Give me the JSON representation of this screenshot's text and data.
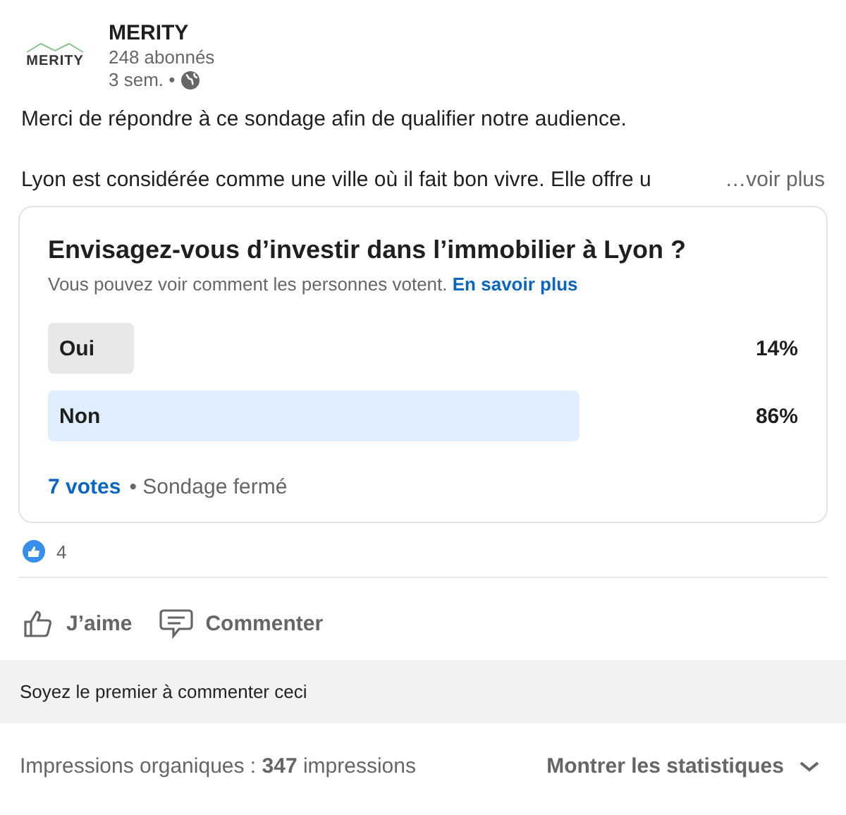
{
  "author": {
    "name": "MERITY",
    "logo_text": "MERITY",
    "followers": "248 abonnés",
    "time": "3 sem. •"
  },
  "body": {
    "lines": [
      "Merci de répondre à ce sondage afin de qualifier notre audience.",
      "Lyon est considérée comme une ville où il fait bon vivre. Elle offre u"
    ],
    "more": "…voir plus"
  },
  "poll": {
    "question": "Envisagez-vous d’investir dans l’immobilier à Lyon ?",
    "note": "Vous pouvez voir comment les personnes votent.",
    "note_link": "En savoir plus",
    "options": [
      {
        "label": "Oui",
        "percent": "14%",
        "level": 0.14,
        "selected": false
      },
      {
        "label": "Non",
        "percent": "86%",
        "level": 0.86,
        "selected": true
      }
    ],
    "votes": "7 votes",
    "status": "• Sondage fermé"
  },
  "reactions": {
    "count": "4"
  },
  "actions": [
    {
      "kind": "like",
      "label": "J’aime"
    },
    {
      "kind": "comment",
      "label": "Commenter"
    }
  ],
  "comment_prompt": "Soyez le premier à commenter ceci",
  "footer": {
    "impressions": "Impressions organiques : **347** impressions",
    "stats": "Montrer les statistiques"
  }
}
